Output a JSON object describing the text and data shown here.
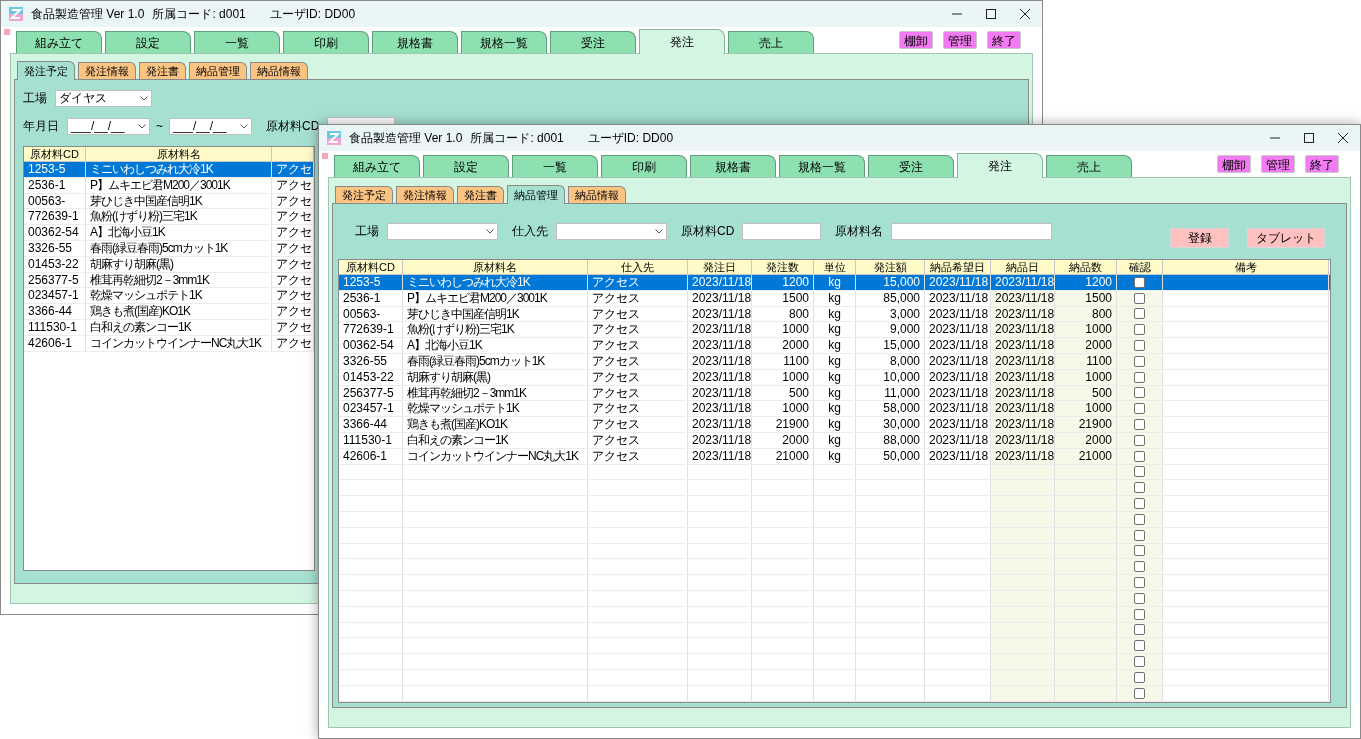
{
  "windows": [
    {
      "title": {
        "app": "食品製造管理 Ver 1.0",
        "affiliation": "所属コード: d001",
        "user": "ユーザID: DD00"
      },
      "tabs": [
        {
          "label": "組み立て",
          "selected": false
        },
        {
          "label": "設定",
          "selected": false
        },
        {
          "label": "一覧",
          "selected": false
        },
        {
          "label": "印刷",
          "selected": false
        },
        {
          "label": "規格書",
          "selected": false
        },
        {
          "label": "規格一覧",
          "selected": false
        },
        {
          "label": "受注",
          "selected": false
        },
        {
          "label": "発注",
          "selected": true
        },
        {
          "label": "売上",
          "selected": false
        }
      ],
      "tool_buttons": [
        "棚卸",
        "管理",
        "終了"
      ],
      "subtabs": [
        {
          "label": "発注予定",
          "selected": true
        },
        {
          "label": "発注情報",
          "selected": false
        },
        {
          "label": "発注書",
          "selected": false
        },
        {
          "label": "納品管理",
          "selected": false
        },
        {
          "label": "納品情報",
          "selected": false
        }
      ],
      "filter_rows": [
        [
          {
            "kind": "label",
            "text": "工場"
          },
          {
            "kind": "dropdown",
            "value": "ダイヤス"
          }
        ],
        [
          {
            "kind": "label",
            "text": "年月日"
          },
          {
            "kind": "dropdown",
            "value": "___/__/__"
          },
          {
            "kind": "text",
            "text": "~"
          },
          {
            "kind": "dropdown",
            "value": "___/__/__"
          },
          {
            "kind": "label",
            "text": "原材料CD"
          },
          {
            "kind": "input"
          }
        ]
      ],
      "table": {
        "columns": [
          "原材料CD",
          "原材料名"
        ],
        "rows": [
          {
            "selected": true,
            "cells": [
              "1253-5",
              "ミニいわしつみれ大冷1K",
              "アクセ"
            ]
          },
          {
            "selected": false,
            "cells": [
              "2536-1",
              "P】ムキエビ君M200／3001K",
              "アクセ"
            ]
          },
          {
            "selected": false,
            "cells": [
              "00563-",
              "芽ひじき中国産信明1K",
              "アクセ"
            ]
          },
          {
            "selected": false,
            "cells": [
              "772639-1",
              "魚粉(けずり粉)三宅1K",
              "アクセ"
            ]
          },
          {
            "selected": false,
            "cells": [
              "00362-54",
              "A】北海小豆1K",
              "アクセ"
            ]
          },
          {
            "selected": false,
            "cells": [
              "3326-55",
              "春雨(緑豆春雨)5cmカット1K",
              "アクセ"
            ]
          },
          {
            "selected": false,
            "cells": [
              "01453-22",
              "胡麻すり胡麻(黒)",
              "アクセ"
            ]
          },
          {
            "selected": false,
            "cells": [
              "256377-5",
              "椎茸再乾細切2－3mm1K",
              "アクセ"
            ]
          },
          {
            "selected": false,
            "cells": [
              "023457-1",
              "乾燥マッシュポテト1K",
              "アクセ"
            ]
          },
          {
            "selected": false,
            "cells": [
              "3366-44",
              "鶏きも煮(国産)KO1K",
              "アクセ"
            ]
          },
          {
            "selected": false,
            "cells": [
              "111530-1",
              "白和えの素ンコー1K",
              "アクセ"
            ]
          },
          {
            "selected": false,
            "cells": [
              "42606-1",
              "コインカットウインナーNC丸大1K",
              "アクセ"
            ]
          }
        ]
      }
    },
    {
      "title": {
        "app": "食品製造管理 Ver 1.0",
        "affiliation": "所属コード: d001",
        "user": "ユーザID: DD00"
      },
      "tabs": [
        {
          "label": "組み立て",
          "selected": false
        },
        {
          "label": "設定",
          "selected": false
        },
        {
          "label": "一覧",
          "selected": false
        },
        {
          "label": "印刷",
          "selected": false
        },
        {
          "label": "規格書",
          "selected": false
        },
        {
          "label": "規格一覧",
          "selected": false
        },
        {
          "label": "受注",
          "selected": false
        },
        {
          "label": "発注",
          "selected": true
        },
        {
          "label": "売上",
          "selected": false
        }
      ],
      "tool_buttons": [
        "棚卸",
        "管理",
        "終了"
      ],
      "subtabs": [
        {
          "label": "発注予定",
          "selected": false
        },
        {
          "label": "発注情報",
          "selected": false
        },
        {
          "label": "発注書",
          "selected": false
        },
        {
          "label": "納品管理",
          "selected": true
        },
        {
          "label": "納品情報",
          "selected": false
        }
      ],
      "filter_rows": [
        [
          {
            "kind": "label",
            "text": "工場"
          },
          {
            "kind": "dropdown"
          },
          {
            "kind": "label",
            "text": "仕入先"
          },
          {
            "kind": "dropdown"
          },
          {
            "kind": "label",
            "text": "原材料CD"
          },
          {
            "kind": "input"
          },
          {
            "kind": "label",
            "text": "原材料名"
          },
          {
            "kind": "input"
          }
        ]
      ],
      "action_buttons": [
        "登録",
        "タブレット"
      ],
      "table": {
        "columns": [
          "原材料CD",
          "原材料名",
          "仕入先",
          "発注日",
          "発注数",
          "単位",
          "発注額",
          "納品希望日",
          "納品日",
          "納品数",
          "確認",
          "備考"
        ],
        "rows": [
          {
            "selected": true,
            "checked": false,
            "cells": [
              "1253-5",
              "ミニいわしつみれ大冷1K",
              "アクセス",
              "2023/11/18",
              "1200",
              "kg",
              "15,000",
              "2023/11/18",
              "2023/11/18",
              "1200"
            ]
          },
          {
            "selected": false,
            "checked": false,
            "cells": [
              "2536-1",
              "P】ムキエビ君M200／3001K",
              "アクセス",
              "2023/11/18",
              "1500",
              "kg",
              "85,000",
              "2023/11/18",
              "2023/11/18",
              "1500"
            ]
          },
          {
            "selected": false,
            "checked": false,
            "cells": [
              "00563-",
              "芽ひじき中国産信明1K",
              "アクセス",
              "2023/11/18",
              "800",
              "kg",
              "3,000",
              "2023/11/18",
              "2023/11/18",
              "800"
            ]
          },
          {
            "selected": false,
            "checked": false,
            "cells": [
              "772639-1",
              "魚粉(けずり粉)三宅1K",
              "アクセス",
              "2023/11/18",
              "1000",
              "kg",
              "9,000",
              "2023/11/18",
              "2023/11/18",
              "1000"
            ]
          },
          {
            "selected": false,
            "checked": false,
            "cells": [
              "00362-54",
              "A】北海小豆1K",
              "アクセス",
              "2023/11/18",
              "2000",
              "kg",
              "15,000",
              "2023/11/18",
              "2023/11/18",
              "2000"
            ]
          },
          {
            "selected": false,
            "checked": false,
            "cells": [
              "3326-55",
              "春雨(緑豆春雨)5cmカット1K",
              "アクセス",
              "2023/11/18",
              "1100",
              "kg",
              "8,000",
              "2023/11/18",
              "2023/11/18",
              "1100"
            ]
          },
          {
            "selected": false,
            "checked": false,
            "cells": [
              "01453-22",
              "胡麻すり胡麻(黒)",
              "アクセス",
              "2023/11/18",
              "1000",
              "kg",
              "10,000",
              "2023/11/18",
              "2023/11/18",
              "1000"
            ]
          },
          {
            "selected": false,
            "checked": false,
            "cells": [
              "256377-5",
              "椎茸再乾細切2－3mm1K",
              "アクセス",
              "2023/11/18",
              "500",
              "kg",
              "11,000",
              "2023/11/18",
              "2023/11/18",
              "500"
            ]
          },
          {
            "selected": false,
            "checked": false,
            "cells": [
              "023457-1",
              "乾燥マッシュポテト1K",
              "アクセス",
              "2023/11/18",
              "1000",
              "kg",
              "58,000",
              "2023/11/18",
              "2023/11/18",
              "1000"
            ]
          },
          {
            "selected": false,
            "checked": false,
            "cells": [
              "3366-44",
              "鶏きも煮(国産)KO1K",
              "アクセス",
              "2023/11/18",
              "21900",
              "kg",
              "30,000",
              "2023/11/18",
              "2023/11/18",
              "21900"
            ]
          },
          {
            "selected": false,
            "checked": false,
            "cells": [
              "111530-1",
              "白和えの素ンコー1K",
              "アクセス",
              "2023/11/18",
              "2000",
              "kg",
              "88,000",
              "2023/11/18",
              "2023/11/18",
              "2000"
            ]
          },
          {
            "selected": false,
            "checked": false,
            "cells": [
              "42606-1",
              "コインカットウインナーNC丸大1K",
              "アクセス",
              "2023/11/18",
              "21000",
              "kg",
              "50,000",
              "2023/11/18",
              "2023/11/18",
              "21000"
            ]
          },
          {
            "selected": false,
            "checked": false
          },
          {
            "selected": false,
            "checked": false
          },
          {
            "selected": false,
            "checked": false
          },
          {
            "selected": false,
            "checked": false
          },
          {
            "selected": false,
            "checked": false
          },
          {
            "selected": false,
            "checked": false
          },
          {
            "selected": false,
            "checked": false
          },
          {
            "selected": false,
            "checked": false
          },
          {
            "selected": false,
            "checked": false
          },
          {
            "selected": false,
            "checked": false
          },
          {
            "selected": false,
            "checked": false
          },
          {
            "selected": false,
            "checked": false
          },
          {
            "selected": false,
            "checked": false
          },
          {
            "selected": false,
            "checked": false
          },
          {
            "selected": false,
            "checked": false
          }
        ]
      }
    }
  ]
}
